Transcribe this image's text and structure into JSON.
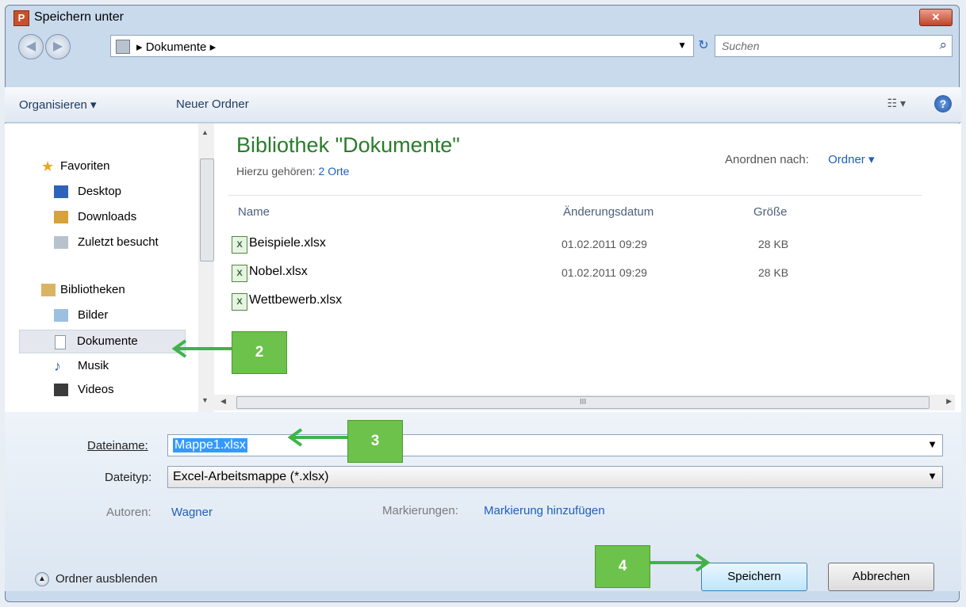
{
  "window": {
    "title": "Speichern unter",
    "app_icon_letter": "P",
    "close_label": "✕"
  },
  "address": {
    "crumb": "▸ Dokumente ▸",
    "search_placeholder": "Suchen"
  },
  "toolbar": {
    "organize": "Organisieren ▾",
    "new_folder": "Neuer Ordner",
    "views": "☷ ▾",
    "help": "?"
  },
  "nav": {
    "favorites": "Favoriten",
    "desktop": "Desktop",
    "downloads": "Downloads",
    "recent": "Zuletzt besucht",
    "libraries": "Bibliotheken",
    "pictures": "Bilder",
    "documents": "Dokumente",
    "music": "Musik",
    "videos": "Videos"
  },
  "library": {
    "title": "Bibliothek \"Dokumente\"",
    "includes_label": "Hierzu gehören:",
    "includes_link": "2 Orte",
    "arrange_label": "Anordnen nach:",
    "arrange_value": "Ordner ▾"
  },
  "columns": {
    "name": "Name",
    "date": "Änderungsdatum",
    "size": "Größe"
  },
  "files": [
    {
      "name": "Beispiele.xlsx",
      "date": "01.02.2011 09:29",
      "size": "28 KB"
    },
    {
      "name": "Nobel.xlsx",
      "date": "01.02.2011 09:29",
      "size": "28 KB"
    },
    {
      "name": "Wettbewerb.xlsx",
      "date": "",
      "size": ""
    }
  ],
  "form": {
    "filename_label": "Dateiname:",
    "filename_value": "Mappe1.xlsx",
    "filetype_label": "Dateityp:",
    "filetype_value": "Excel-Arbeitsmappe (*.xlsx)",
    "authors_label": "Autoren:",
    "authors_value": "Wagner",
    "tags_label": "Markierungen:",
    "tags_value": "Markierung hinzufügen",
    "hide_folders": "Ordner ausblenden",
    "save": "Speichern",
    "cancel": "Abbrechen"
  },
  "callouts": {
    "step2": "2",
    "step3": "3",
    "step4": "4"
  }
}
